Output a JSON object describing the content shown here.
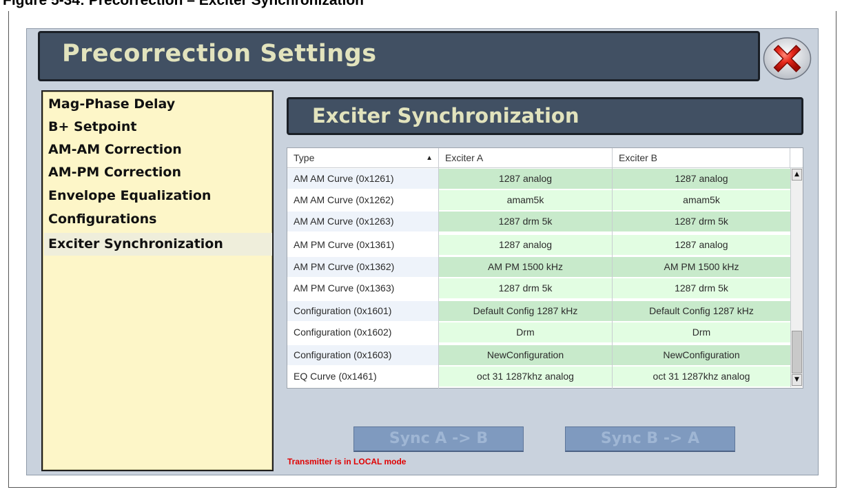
{
  "document": {
    "caption": "Figure 5-34: Precorrection – Exciter Synchronization"
  },
  "window": {
    "title": "Precorrection Settings",
    "close_icon": "close-x-icon"
  },
  "sidebar": {
    "items": [
      {
        "label": "Mag-Phase Delay"
      },
      {
        "label": "B+ Setpoint"
      },
      {
        "label": "AM-AM Correction"
      },
      {
        "label": "AM-PM Correction"
      },
      {
        "label": "Envelope Equalization"
      },
      {
        "label": "Configurations"
      },
      {
        "label": "Exciter Synchronization",
        "selected": true
      }
    ]
  },
  "main": {
    "section_title": "Exciter Synchronization",
    "table": {
      "columns": [
        "Type",
        "Exciter A",
        "Exciter B"
      ],
      "sort_indicator": "▲",
      "rows": [
        {
          "type": "AM AM Curve (0x1261)",
          "exciter_a": "1287 analog",
          "exciter_b": "1287 analog"
        },
        {
          "type": "AM AM Curve (0x1262)",
          "exciter_a": "amam5k",
          "exciter_b": "amam5k"
        },
        {
          "type": "AM AM Curve (0x1263)",
          "exciter_a": "1287 drm 5k",
          "exciter_b": "1287 drm 5k"
        },
        {
          "type": "AM PM Curve (0x1361)",
          "exciter_a": "1287 analog",
          "exciter_b": "1287 analog"
        },
        {
          "type": "AM PM Curve (0x1362)",
          "exciter_a": "AM PM 1500 kHz",
          "exciter_b": "AM PM 1500 kHz"
        },
        {
          "type": "AM PM Curve (0x1363)",
          "exciter_a": "1287 drm 5k",
          "exciter_b": "1287 drm 5k"
        },
        {
          "type": "Configuration (0x1601)",
          "exciter_a": "Default Config 1287 kHz",
          "exciter_b": "Default Config 1287 kHz"
        },
        {
          "type": "Configuration (0x1602)",
          "exciter_a": "Drm",
          "exciter_b": "Drm"
        },
        {
          "type": "Configuration (0x1603)",
          "exciter_a": "NewConfiguration",
          "exciter_b": "NewConfiguration"
        },
        {
          "type": "EQ Curve (0x1461)",
          "exciter_a": "oct 31 1287khz analog",
          "exciter_b": "oct 31 1287khz analog"
        }
      ],
      "scroll_up": "▲",
      "scroll_down": "▼"
    },
    "buttons": {
      "sync_a_to_b": "Sync A -> B",
      "sync_b_to_a": "Sync B -> A"
    },
    "status": "Transmitter is in LOCAL mode"
  },
  "colors": {
    "title_bar_bg": "#415063",
    "title_text": "#e2e3bd",
    "sidebar_bg": "#fdf6c8",
    "cell_green": "#c8eacb",
    "status_red": "#e00000"
  }
}
